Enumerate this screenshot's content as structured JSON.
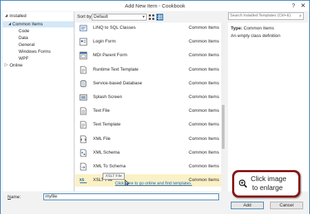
{
  "window": {
    "title": "Add New Item - Cookbook",
    "help_glyph": "?",
    "close_glyph": "✕"
  },
  "tree": {
    "installed": "Installed",
    "common_items": "Common Items",
    "children": [
      "Code",
      "Data",
      "General",
      "Windows Forms",
      "WPF"
    ],
    "online": "Online"
  },
  "sortbar": {
    "label": "Sort by:",
    "value": "Default"
  },
  "search": {
    "placeholder": "Search Installed Templates (Ctrl+E)"
  },
  "items": [
    {
      "name": "LINQ to SQL Classes",
      "category": "Common Items",
      "icon": "linq-icon"
    },
    {
      "name": "Login Form",
      "category": "Common Items",
      "icon": "login-form-icon"
    },
    {
      "name": "MDI Parent Form",
      "category": "Common Items",
      "icon": "mdi-form-icon"
    },
    {
      "name": "Runtime Text Template",
      "category": "Common Items",
      "icon": "text-template-icon"
    },
    {
      "name": "Service-based Database",
      "category": "Common Items",
      "icon": "database-icon"
    },
    {
      "name": "Splash Screen",
      "category": "Common Items",
      "icon": "splash-screen-icon"
    },
    {
      "name": "Text File",
      "category": "Common Items",
      "icon": "text-file-icon"
    },
    {
      "name": "Text Template",
      "category": "Common Items",
      "icon": "text-template-icon"
    },
    {
      "name": "XML File",
      "category": "Common Items",
      "icon": "xml-file-icon"
    },
    {
      "name": "XML Schema",
      "category": "Common Items",
      "icon": "xml-schema-icon"
    },
    {
      "name": "XML To Schema",
      "category": "Common Items",
      "icon": "xml-to-schema-icon"
    },
    {
      "name": "XSLT File",
      "category": "Common Items",
      "icon": "xslt-file-icon"
    }
  ],
  "selected_index": 11,
  "tooltip": "XSLT File",
  "online_link": "Click here to go online and find templates.",
  "details": {
    "type_label": "Type:",
    "type_value": "Common Items",
    "description": "An empty class definition"
  },
  "bottom": {
    "name_label": "Name:",
    "name_value": "myfile",
    "add_label": "Add",
    "cancel_label": "Cancel"
  },
  "badge": {
    "line1": "Click image",
    "line2": "to enlarge"
  },
  "colors": {
    "accent": "#3c7fb1",
    "selection": "#fbf1c7",
    "tree_selection": "#d4e8f8",
    "badge": "#8a1414",
    "link": "#1565c0"
  }
}
